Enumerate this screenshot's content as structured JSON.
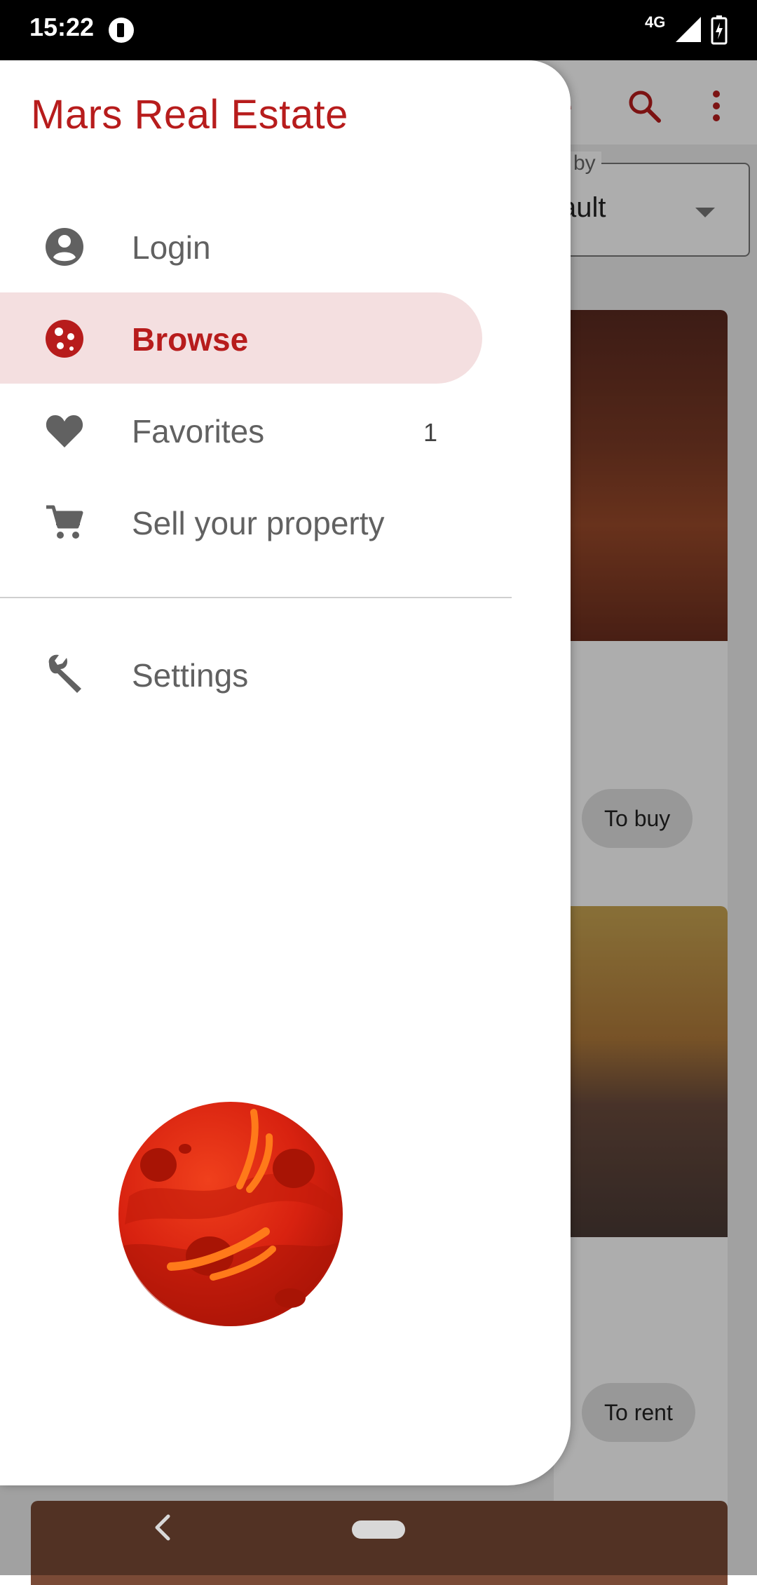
{
  "status_bar": {
    "time": "15:22",
    "network": "4G",
    "app_icon": "notification-app-icon",
    "signal_icon": "cell-signal-icon",
    "battery_icon": "battery-charging-icon"
  },
  "background_screen": {
    "title_fragment": "e",
    "sort_label": "by",
    "sort_value": "ault",
    "cards": [
      {
        "chip": "To buy"
      },
      {
        "chip": "To rent"
      }
    ],
    "icons": [
      "search-icon",
      "more-vert-icon"
    ]
  },
  "drawer": {
    "title": "Mars Real Estate",
    "items": [
      {
        "label": "Login",
        "icon": "account-circle-icon",
        "selected": false,
        "badge": ""
      },
      {
        "label": "Browse",
        "icon": "planet-icon",
        "selected": true,
        "badge": ""
      },
      {
        "label": "Favorites",
        "icon": "heart-icon",
        "selected": false,
        "badge": "1"
      },
      {
        "label": "Sell your property",
        "icon": "cart-icon",
        "selected": false,
        "badge": ""
      },
      {
        "label": "Settings",
        "icon": "wrench-icon",
        "selected": false,
        "badge": ""
      }
    ],
    "logo": "mars-planet-logo"
  },
  "colors": {
    "accent": "#b71c1c",
    "selected_bg": "#f4dfe0",
    "item_text": "#616161"
  },
  "nav_bar": {
    "back_icon": "back-chevron-icon",
    "home_pill": "home-pill"
  }
}
